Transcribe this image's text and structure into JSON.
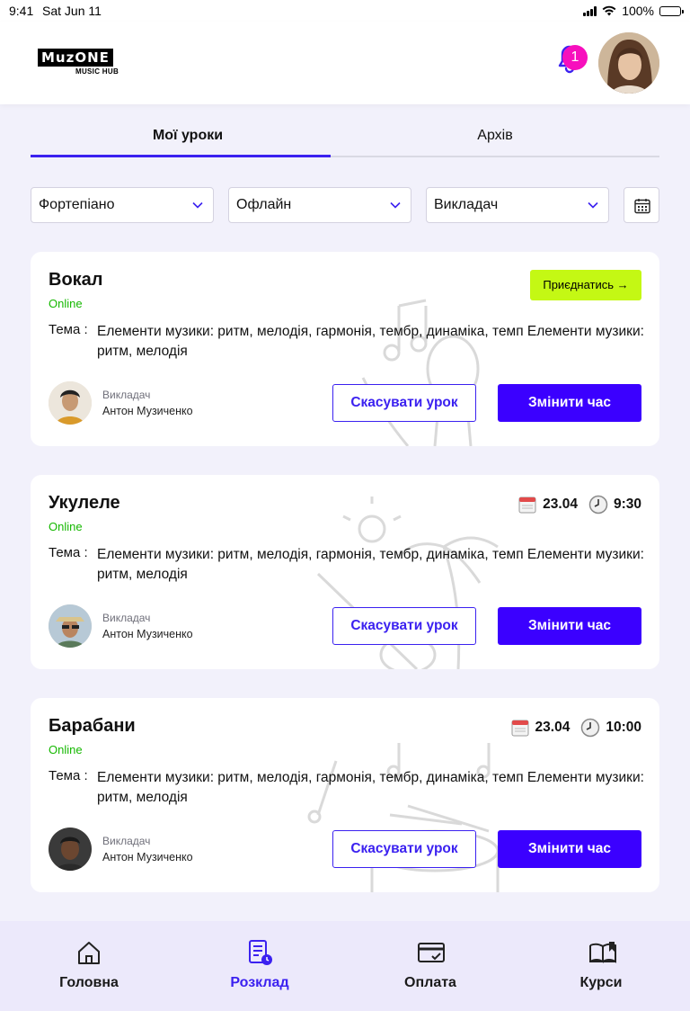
{
  "status_bar": {
    "time": "9:41",
    "date": "Sat Jun 11",
    "battery": "100%"
  },
  "header": {
    "logo_word": "MuzONE",
    "logo_sub": "MUSIC HUB",
    "notification_count": "1"
  },
  "tabs": [
    {
      "label": "Мої уроки",
      "active": true
    },
    {
      "label": "Архів",
      "active": false
    }
  ],
  "filters": {
    "instrument": "Фортепіано",
    "format": "Офлайн",
    "teacher": "Викладач"
  },
  "lessons": [
    {
      "title": "Вокал",
      "mode": "Online",
      "topic_label": "Тема :",
      "topic": "Елементи музики: ритм, мелодія, гармонія, тембр, динаміка, темп Елементи музики: ритм, мелодія",
      "join_label": "Приєднатись →",
      "teacher_label": "Викладач",
      "teacher_name": "Антон Музиченко",
      "cancel_label": "Скасувати урок",
      "change_label": "Змінити час"
    },
    {
      "title": "Укулеле",
      "mode": "Online",
      "date": "23.04",
      "time": "9:30",
      "topic_label": "Тема :",
      "topic": "Елементи музики: ритм, мелодія, гармонія, тембр, динаміка, темп Елементи музики: ритм, мелодія",
      "teacher_label": "Викладач",
      "teacher_name": "Антон Музиченко",
      "cancel_label": "Скасувати урок",
      "change_label": "Змінити час"
    },
    {
      "title": "Барабани",
      "mode": "Online",
      "date": "23.04",
      "time": "10:00",
      "topic_label": "Тема :",
      "topic": "Елементи музики: ритм, мелодія, гармонія, тембр, динаміка, темп Елементи музики: ритм, мелодія",
      "teacher_label": "Викладач",
      "teacher_name": "Антон Музиченко",
      "cancel_label": "Скасувати урок",
      "change_label": "Змінити час"
    }
  ],
  "bottom_nav": [
    {
      "label": "Головна",
      "icon": "home-icon",
      "active": false
    },
    {
      "label": "Розклад",
      "icon": "schedule-icon",
      "active": true
    },
    {
      "label": "Оплата",
      "icon": "payment-icon",
      "active": false
    },
    {
      "label": "Курси",
      "icon": "courses-icon",
      "active": false
    }
  ],
  "colors": {
    "accent": "#3b21f0",
    "button_primary": "#3b00ff",
    "join_button": "#c4f814",
    "online_green": "#15b800",
    "badge": "#f70fbd",
    "background": "#f2f1fb"
  }
}
